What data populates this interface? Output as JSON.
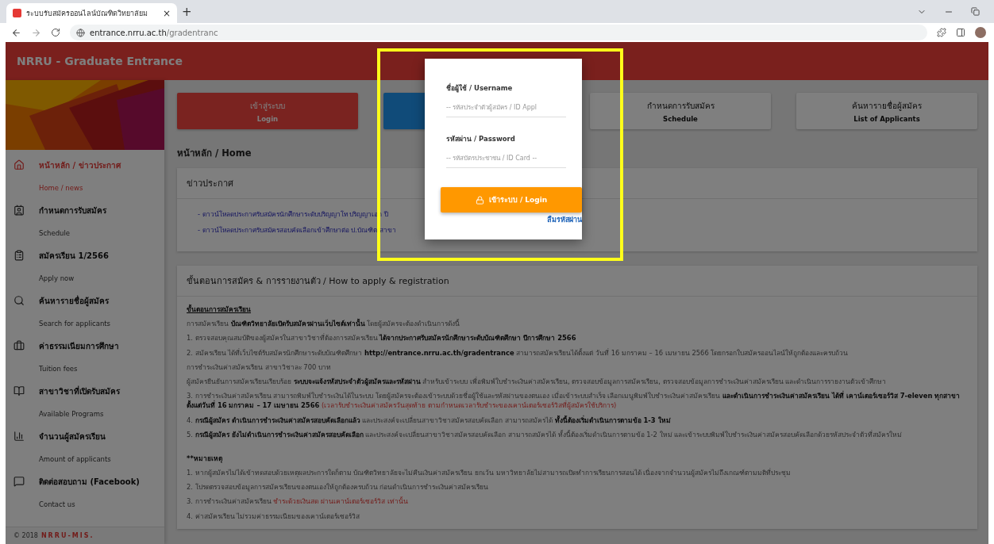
{
  "browser": {
    "tab_title": "ระบบรับสมัครออนไลน์บัณฑิตวิทยาลัยม",
    "tab_close": "×",
    "new_tab": "+",
    "url_host": "entrance.nrru.ac.th",
    "url_path": "/gradentranc"
  },
  "header": {
    "title": "NRRU - Graduate Entrance"
  },
  "sidebar": {
    "items": [
      {
        "kind": "home",
        "title": "หน้าหลัก / ข่าวประกาศ",
        "subtitle": "Home / news",
        "selected": true
      },
      {
        "kind": "calendar",
        "title": "กำหนดการรับสมัคร",
        "subtitle": "Schedule",
        "selected": false
      },
      {
        "kind": "clipboard",
        "title": "สมัครเรียน 1/2566",
        "subtitle": "Apply now",
        "selected": false
      },
      {
        "kind": "search",
        "title": "ค้นหารายชื่อผู้สมัคร",
        "subtitle": "Search for applicants",
        "selected": false
      },
      {
        "kind": "wallet",
        "title": "ค่าธรรมเนียมการศึกษา",
        "subtitle": "Tuition fees",
        "selected": false
      },
      {
        "kind": "book",
        "title": "สาขาวิชาที่เปิดรับสมัคร",
        "subtitle": "Available Programs",
        "selected": false
      },
      {
        "kind": "chart",
        "title": "จำนวนผู้สมัครเรียน",
        "subtitle": "Amount of applicants",
        "selected": false
      },
      {
        "kind": "chat",
        "title": "ติดต่อสอบถาม (Facebook)",
        "subtitle": "Contact us",
        "selected": false
      }
    ],
    "footer": {
      "copyright": "© 2018",
      "brand": "NRRU-MIS."
    }
  },
  "nav_buttons": [
    {
      "title": "เข้าสู่ระบบ",
      "subtitle": "Login",
      "kind": "primary"
    },
    {
      "kind": "info"
    },
    {
      "title": "กำหนดการรับสมัคร",
      "subtitle": "Schedule",
      "kind": "default"
    },
    {
      "title": "ค้นหารายชื่อผู้สมัคร",
      "subtitle": "List of Applicants",
      "kind": "default"
    }
  ],
  "breadcrumb": "หน้าหลัก / Home",
  "news": {
    "title": "ข่าวประกาศ",
    "links": [
      "- ดาวน์โหลดประกาศรับสมัครนักศึกษาระดับปริญญาโท ปริญญาเอก ปี",
      "- ดาวน์โหลดประกาศรับสมัครสอบคัดเลือกเข้าศึกษาต่อ ป.บัณฑิต สาขา"
    ]
  },
  "steps": {
    "title": "ขั้นตอนการสมัคร & การรายงานตัว / How to apply & registration",
    "lines": [
      {
        "kind": "item",
        "segments": [
          {
            "kind": "heading",
            "text": "ขั้นตอนการสมัครเรียน"
          }
        ]
      },
      {
        "kind": "item",
        "segments": [
          {
            "kind": "plain",
            "text": "การสมัครเรียน "
          },
          {
            "kind": "bold",
            "text": "บัณฑิตวิทยาลัยเปิดรับสมัครผ่านเว็บไซต์เท่านั้น"
          },
          {
            "kind": "plain",
            "text": " โดยผู้สมัครจะต้องดำเนินการดังนี้"
          }
        ]
      },
      {
        "kind": "item",
        "segments": [
          {
            "kind": "plain",
            "text": "1. ตรวจสอบคุณสมบัติของผู้สมัครในสาขาวิชาที่ต้องการสมัครเรียน "
          },
          {
            "kind": "bold",
            "text": "ได้จากประกาศรับสมัครนักศึกษาระดับบัณฑิตศึกษา ปีการศึกษา 2566"
          }
        ]
      },
      {
        "kind": "item",
        "segments": [
          {
            "kind": "plain",
            "text": "2. สมัครเรียน ได้ที่เว็บไซต์รับสมัครนักศึกษาระดับบัณฑิตศึกษา "
          },
          {
            "kind": "bold",
            "text": "http://entrance.nrru.ac.th/gradentrance"
          },
          {
            "kind": "plain",
            "text": " สามารถสมัครเรียนได้ตั้งแต่ วันที่ 16 มกราคม – 16 เมษายน 2566 โดยกรอกใบสมัครออนไลน์ให้ถูกต้องและครบถ้วน"
          }
        ]
      },
      {
        "kind": "item",
        "segments": [
          {
            "kind": "plain",
            "text": "การชำระเงินค่าสมัครเรียน สาขาวิชาละ 700 บาท"
          }
        ]
      },
      {
        "kind": "item",
        "segments": [
          {
            "kind": "plain",
            "text": "ผู้สมัครยืนยันการสมัครเรียนเรียบร้อย "
          },
          {
            "kind": "bold",
            "text": "ระบบจะแจ้งรหัสประจำตัวผู้สมัครและรหัสผ่าน"
          },
          {
            "kind": "plain",
            "text": " สำหรับเข้าระบบ เพื่อพิมพ์ใบชำระเงินค่าสมัครเรียน, ตรวจสอบข้อมูลการสมัครเรียน, ตรวจสอบข้อมูลการชำระเงินค่าสมัครเรียน และดำเนินการรายงานตัวเข้าศึกษา"
          }
        ]
      },
      {
        "kind": "item",
        "segments": [
          {
            "kind": "plain",
            "text": "3. การชำระเงินค่าสมัครเรียน สามารถพิมพ์ใบชำระเงินได้ในระบบ โดยผู้สมัครจะต้องเข้าระบบด้วยชื่อผู้ใช้และรหัสผ่านของตนเอง เมื่อเข้าระบบสำเร็จ เลือกเมนูพิมพ์ใบชำระเงินค่าสมัครเรียน "
          },
          {
            "kind": "bold",
            "text": "และดำเนินการชำระเงินค่าสมัครเรียน ได้ที่ เคาน์เตอร์เซอร์วิส 7-eleven ทุกสาขา ตั้งแต่วันที่ 16 มกราคม – 17 เมษายน 2566"
          },
          {
            "kind": "red",
            "text": " (เวลารับชำระเงินค่าสมัครวันสุดท้าย ตามกำหนดเวลารับชำระของเคาน์เตอร์เซอร์วิสที่ผู้สมัครใช้บริการ)"
          }
        ]
      },
      {
        "kind": "item",
        "segments": [
          {
            "kind": "plain",
            "text": "4. "
          },
          {
            "kind": "bold",
            "text": "กรณีผู้สมัคร ดำเนินการชำระเงินค่าสมัครสอบคัดเลือกแล้ว"
          },
          {
            "kind": "plain",
            "text": " และประสงค์จะเปลี่ยนสาขาวิชาสมัครสอบคัดเลือก สามารถสมัครได้ "
          },
          {
            "kind": "bold",
            "text": "ทั้งนี้ต้องเริ่มดำเนินการตามข้อ 1-3 ใหม่"
          }
        ]
      },
      {
        "kind": "item",
        "segments": [
          {
            "kind": "plain",
            "text": "5. "
          },
          {
            "kind": "bold",
            "text": "กรณีผู้สมัคร ยังไม่ดำเนินการชำระเงินค่าสมัครสอบคัดเลือก"
          },
          {
            "kind": "plain",
            "text": " และประสงค์จะเปลี่ยนสาขาวิชาสมัครสอบคัดเลือก สามารถสมัครได้ ทั้งนี้ต้องเริ่มดำเนินการตามข้อ 1-2 ใหม่ และเข้าระบบพิมพ์ใบชำระเงินค่าสมัครสอบคัดเลือกด้วยรหัสประจำตัวที่สมัครใหม่"
          }
        ]
      },
      {
        "kind": "section",
        "segments": [
          {
            "kind": "bold",
            "text": "**หมายเหตุ"
          }
        ]
      },
      {
        "kind": "item",
        "segments": [
          {
            "kind": "plain",
            "text": "1. หากผู้สมัครไม่ได้เข้าทดสอบด้วยเหตุผลประการใดก็ตาม บัณฑิตวิทยาลัยจะไม่คืนเงินค่าสมัครเรียน ยกเว้น มหาวิทยาลัยไม่สามารถเปิดทำการเรียนการสอนได้ เนื่องจากจำนวนผู้สมัครไม่ถึงเกณฑ์ตามมติที่ประชุม"
          }
        ]
      },
      {
        "kind": "item",
        "segments": [
          {
            "kind": "plain",
            "text": "2. โปรดตรวจสอบข้อมูลการสมัครเรียนของตนเองให้ถูกต้องครบถ้วน ก่อนดำเนินการชำระเงินค่าสมัครเรียน"
          }
        ]
      },
      {
        "kind": "item",
        "segments": [
          {
            "kind": "plain",
            "text": "3. การชำระเงินค่าสมัครเรียน "
          },
          {
            "kind": "red",
            "text": "ชำระด้วยเงินสด ผ่านเคาน์เตอร์เซอร์วิส เท่านั้น"
          }
        ]
      },
      {
        "kind": "item",
        "segments": [
          {
            "kind": "plain",
            "text": "4. ค่าสมัครเรียน ไม่รวมค่าธรรมเนียมของเคาน์เตอร์เซอร์วิส"
          }
        ]
      }
    ]
  },
  "login_modal": {
    "username_label": "ชื่อผู้ใช้ / Username",
    "username_placeholder": "-- รหัสประจำตัวผู้สมัคร / ID Appl",
    "password_label": "รหัสผ่าน / Password",
    "password_placeholder": "-- รหัสบัตรประชาชน / ID Card --",
    "submit": "เข้าระบบ / Login",
    "forgot": "ลืมรหัสผ่าน"
  }
}
